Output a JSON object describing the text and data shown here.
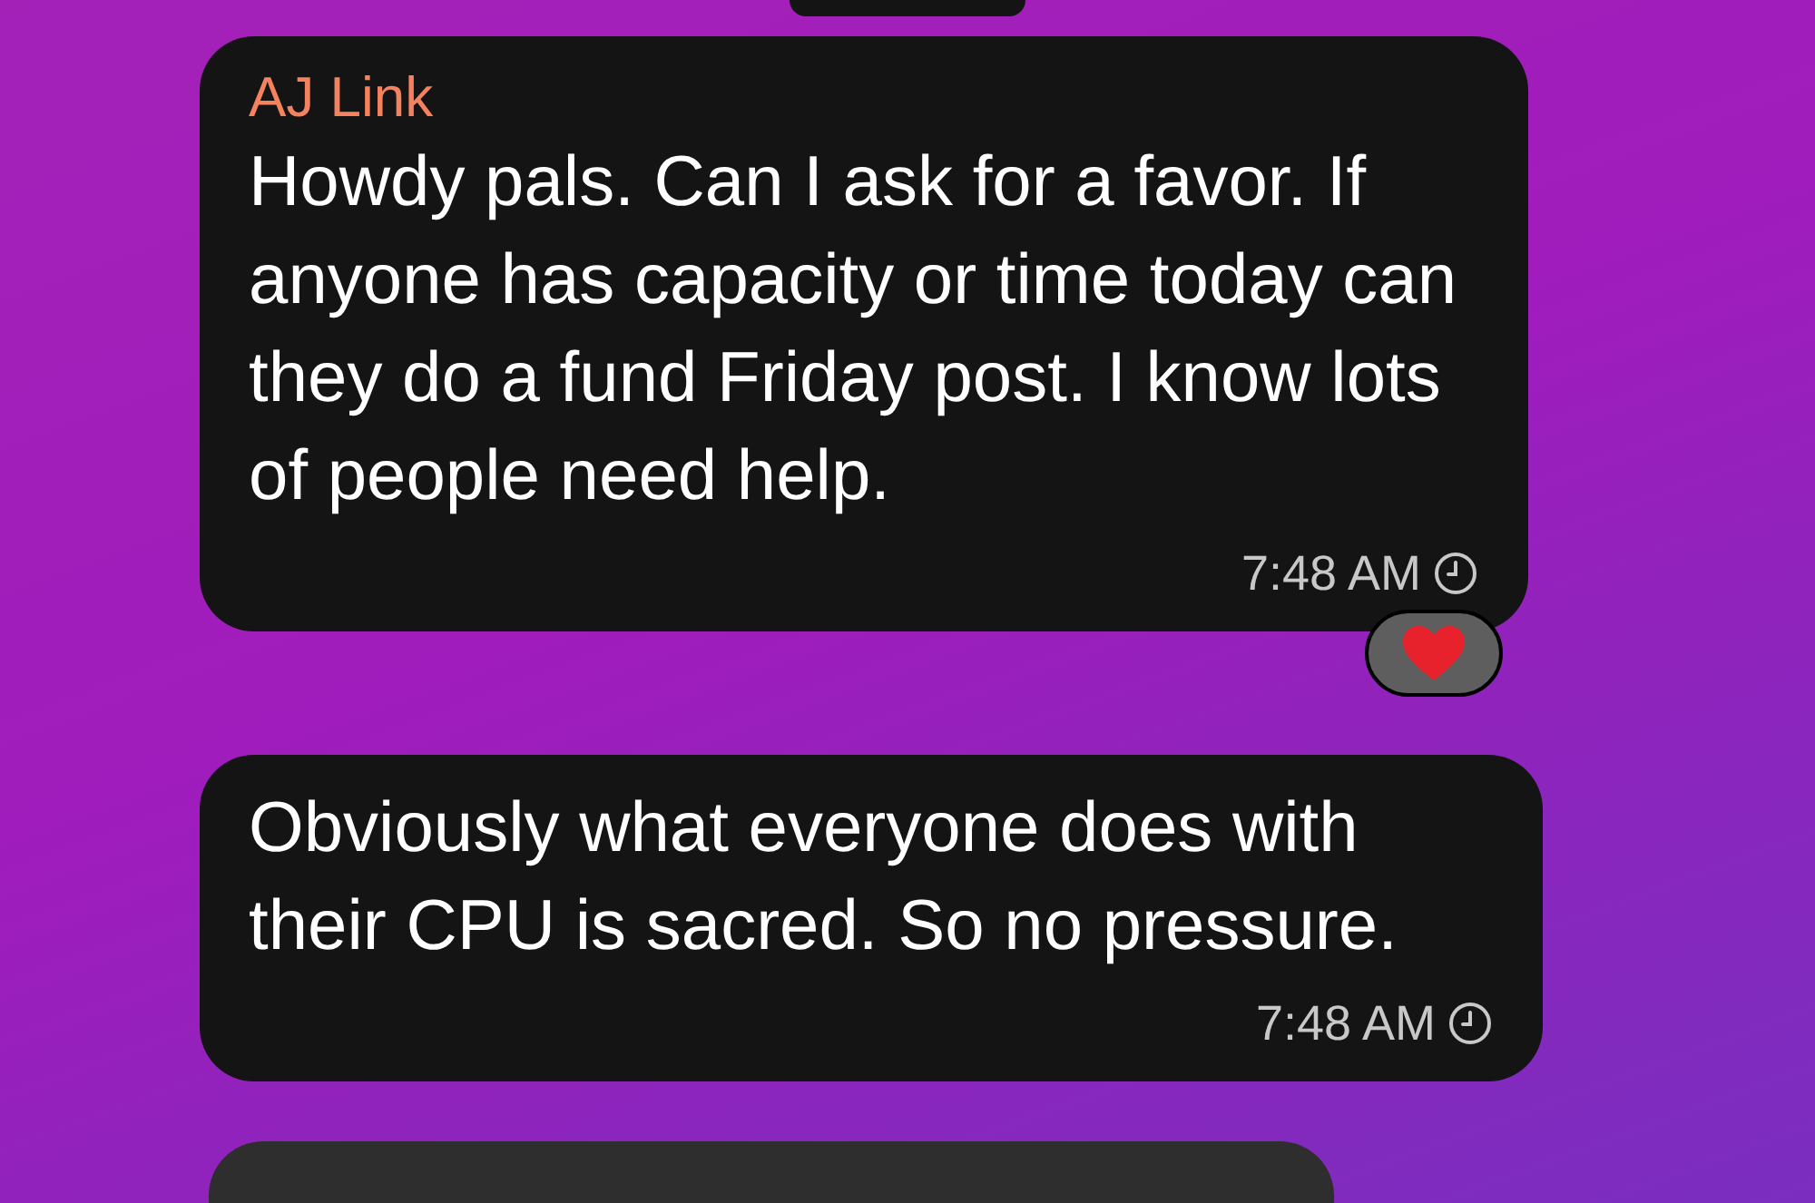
{
  "messages": [
    {
      "sender": "AJ Link",
      "text": "Howdy pals. Can I ask for a favor. If anyone has capacity or time today can they do a fund Friday post. I know lots of people need help.",
      "time": "7:48 AM",
      "pending": true,
      "reaction": true
    },
    {
      "text": "Obviously what everyone does with their CPU is sacred. So no pressure.",
      "time": "7:48 AM",
      "pending": true,
      "reaction": false
    }
  ]
}
